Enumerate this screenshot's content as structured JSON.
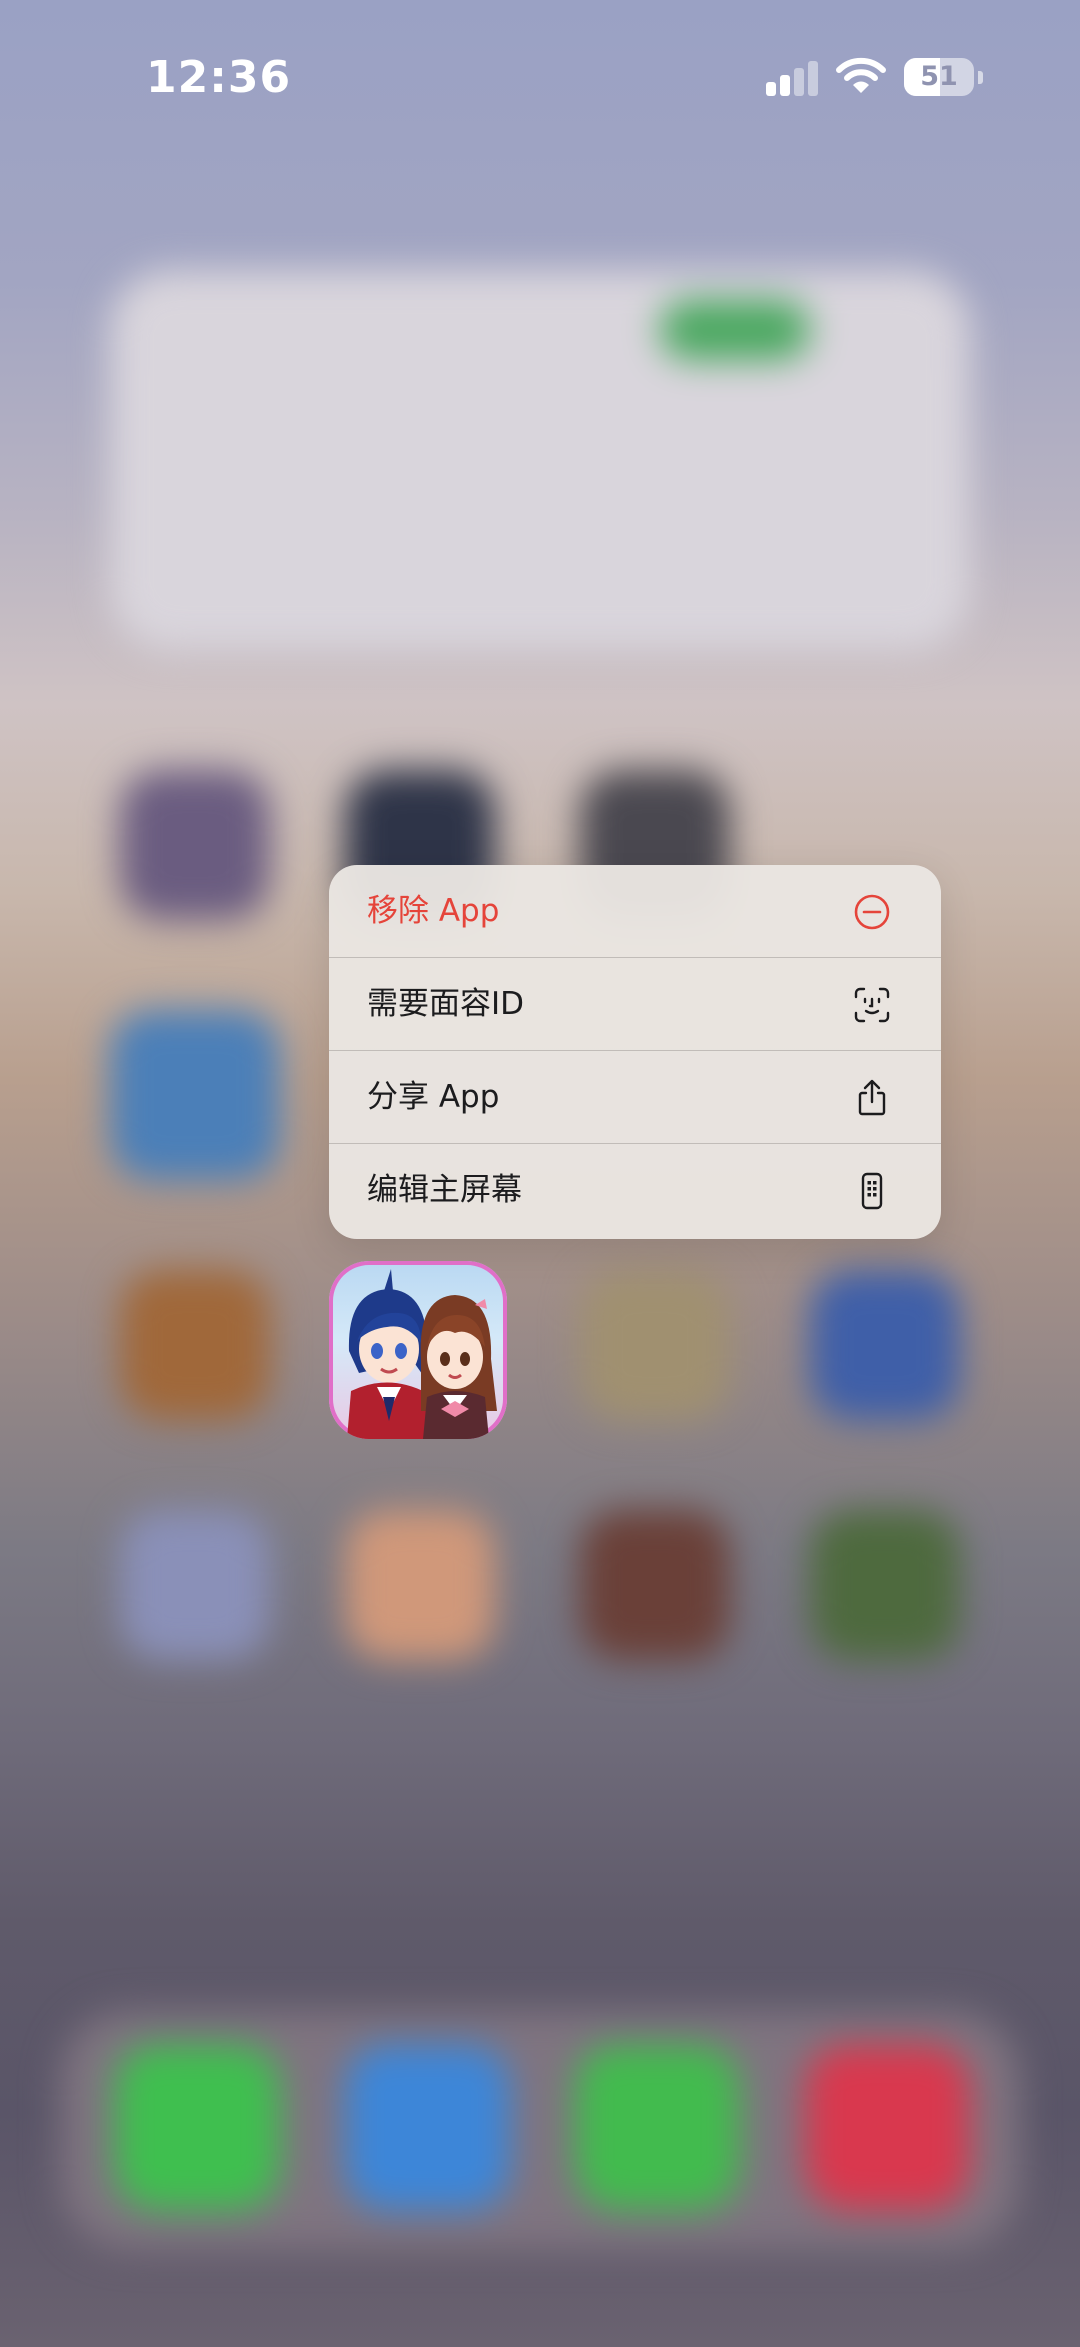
{
  "status_bar": {
    "time": "12:36",
    "battery_level": "51",
    "signal_bars": 2,
    "signal_bars_total": 4
  },
  "context_menu": {
    "items": [
      {
        "label": "移除 App",
        "icon": "minus-circle-icon",
        "destructive": true
      },
      {
        "label": "需要面容ID",
        "icon": "face-id-icon",
        "destructive": false
      },
      {
        "label": "分享 App",
        "icon": "share-icon",
        "destructive": false
      },
      {
        "label": "编辑主屏幕",
        "icon": "phone-icon",
        "destructive": false
      }
    ]
  },
  "colors": {
    "destructive": "#e5443a",
    "menu_text": "#1c1c1e",
    "menu_background": "#eae6e2"
  }
}
